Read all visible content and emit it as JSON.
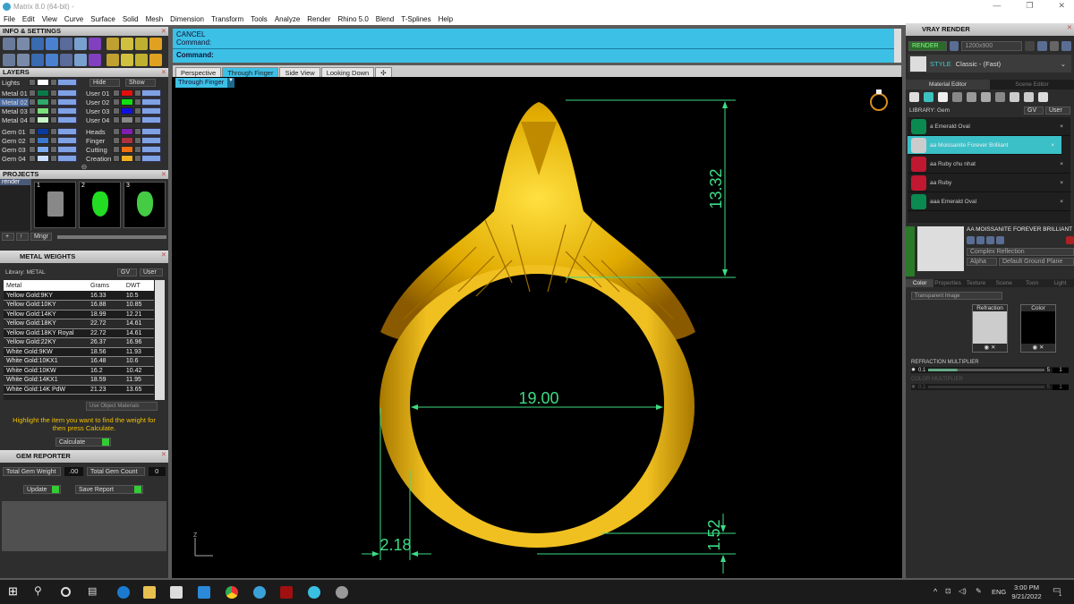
{
  "window": {
    "title": "Matrix 8.0 (64-bit) -",
    "controls": [
      "—",
      "❐",
      "✕"
    ]
  },
  "menu": [
    "File",
    "Edit",
    "View",
    "Curve",
    "Surface",
    "Solid",
    "Mesh",
    "Dimension",
    "Transform",
    "Tools",
    "Analyze",
    "Render",
    "Rhino 5.0",
    "Blend",
    "T-Splines",
    "Help"
  ],
  "info_panel": {
    "title": "INFO & SETTINGS"
  },
  "layers": {
    "title": "LAYERS",
    "lights": "Lights",
    "hide": "Hide",
    "show": "Show",
    "left": [
      {
        "name": "Metal 01",
        "color": "#0a7a4a"
      },
      {
        "name": "Metal 02",
        "color": "#2fa86a"
      },
      {
        "name": "Metal 03",
        "color": "#7ae07a"
      },
      {
        "name": "Metal 04",
        "color": "#c8f5c8"
      },
      {
        "name": "Gem 01",
        "color": "#0a3aa0"
      },
      {
        "name": "Gem 02",
        "color": "#3a78d0"
      },
      {
        "name": "Gem 03",
        "color": "#7aaaf0"
      },
      {
        "name": "Gem 04",
        "color": "#c8dcff"
      }
    ],
    "right": [
      {
        "name": "User 01",
        "color": "#e01010"
      },
      {
        "name": "User 02",
        "color": "#10e010"
      },
      {
        "name": "User 03",
        "color": "#1010e0"
      },
      {
        "name": "User 04",
        "color": "#888888"
      },
      {
        "name": "Heads",
        "color": "#8020b0"
      },
      {
        "name": "Finger",
        "color": "#b03040"
      },
      {
        "name": "Cutting",
        "color": "#f07010"
      },
      {
        "name": "Creation",
        "color": "#f0b020"
      }
    ],
    "selected": "Metal 02"
  },
  "projects": {
    "title": "PROJECTS",
    "items": [
      "render"
    ],
    "thumbs": [
      "1",
      "2",
      "3"
    ],
    "mngr": "Mngr"
  },
  "metal_weights": {
    "title": "METAL WEIGHTS",
    "library": "Library: METAL",
    "gv": "GV",
    "user": "User",
    "columns": [
      "Metal",
      "Grams",
      "DWT"
    ],
    "rows": [
      [
        "Yellow Gold:9KY",
        "16.33",
        "10.5"
      ],
      [
        "Yellow Gold:10KY",
        "16.88",
        "10.85"
      ],
      [
        "Yellow Gold:14KY",
        "18.99",
        "12.21"
      ],
      [
        "Yellow Gold:18KY",
        "22.72",
        "14.61"
      ],
      [
        "Yellow Gold:18KY Royal",
        "22.72",
        "14.61"
      ],
      [
        "Yellow Gold:22KY",
        "26.37",
        "16.96"
      ],
      [
        "White Gold:9KW",
        "18.56",
        "11.93"
      ],
      [
        "White Gold:10KX1",
        "16.48",
        "10.6"
      ],
      [
        "White Gold:10KW",
        "16.2",
        "10.42"
      ],
      [
        "White Gold:14KX1",
        "18.59",
        "11.95"
      ],
      [
        "White Gold:14K PdW",
        "21.23",
        "13.65"
      ]
    ],
    "use_object_materials": "Use Object Materials",
    "hint": "Highlight the item you want to find the weight for then press Calculate.",
    "calculate": "Calculate"
  },
  "gem_reporter": {
    "title": "GEM REPORTER",
    "total_weight_label": "Total Gem Weight",
    "total_weight": ".00",
    "total_count_label": "Total Gem Count",
    "total_count": "0",
    "update": "Update",
    "save_report": "Save Report"
  },
  "command": {
    "line1": "CANCEL",
    "line2": "Command:",
    "prompt": "Command:"
  },
  "view_tabs": [
    "Perspective",
    "Through Finger",
    "Side View",
    "Looking Down",
    "✣"
  ],
  "active_view": "Through Finger",
  "viewport": {
    "label": "Through Finger",
    "dims": {
      "height": "13.32",
      "inner_diameter": "19.00",
      "side": "2.18",
      "bottom": "1.52"
    },
    "axis": "Z",
    "metal_color": "#d9a400",
    "dim_color": "#3ddc84"
  },
  "vray": {
    "title": "VRAY RENDER",
    "render": "RENDER",
    "resolution": "1200x900",
    "style_label": "STYLE",
    "style": "Classic - (Fast)",
    "tabs": [
      "Material Editor",
      "Scene Editor"
    ],
    "library": "LIBRARY: Gem",
    "gv": "GV",
    "user": "User",
    "materials": [
      {
        "name": "a Emerald Oval",
        "color": "#0a8a50"
      },
      {
        "name": "aa Moissanite Forever Brilliant",
        "color": "#cccccc",
        "selected": true
      },
      {
        "name": "aa Ruby chu nhat",
        "color": "#c01830"
      },
      {
        "name": "aa Ruby",
        "color": "#c01830"
      },
      {
        "name": "aaa Emerald Oval",
        "color": "#0a8a50"
      }
    ],
    "selected_material": "AA MOISSANITE FOREVER BRILLIANT",
    "reflection": "Complex Reflection",
    "alpha": "Alpha",
    "ground": "Default Ground Plane",
    "prop_tabs": [
      "Color",
      "Properties",
      "Texture",
      "Scene",
      "Toon",
      "Light"
    ],
    "color_mode": "Transparent Image",
    "refraction": "Refraction",
    "color": "Color",
    "refraction_multiplier": {
      "label": "REFRACTION MULTIPLIER",
      "min": "0.1",
      "max": "5",
      "value": "1"
    },
    "color_multiplier": {
      "label": "COLOR MULTIPLIER",
      "min": "0.1",
      "max": "5",
      "value": "1"
    }
  },
  "taskbar": {
    "time": "3:00 PM",
    "date": "9/21/2022",
    "lang": "ENG",
    "notifications": "1"
  }
}
